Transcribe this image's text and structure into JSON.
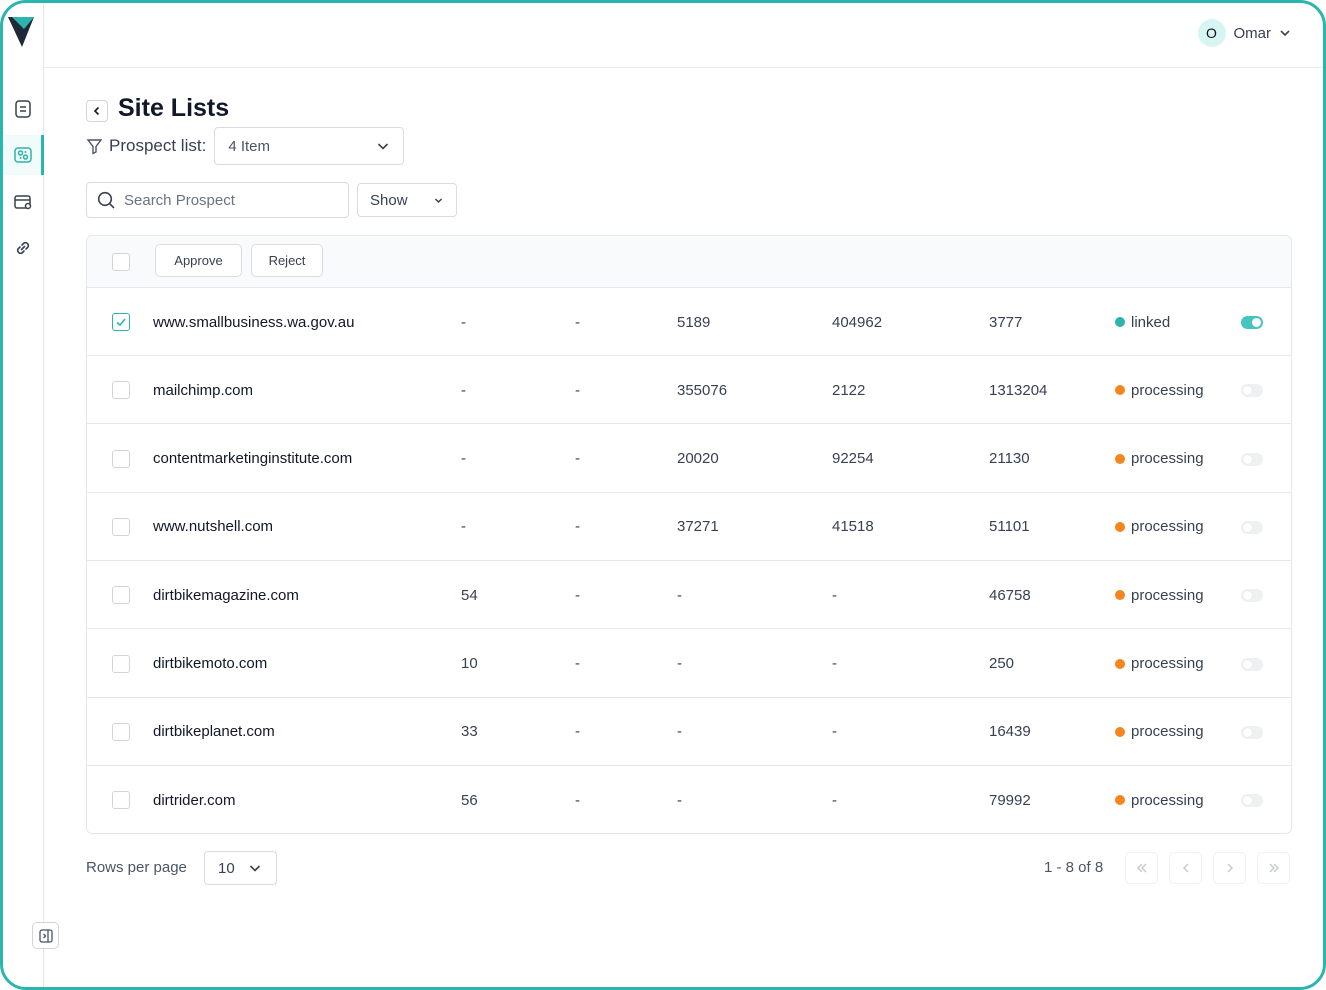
{
  "user": {
    "initial": "O",
    "name": "Omar"
  },
  "page": {
    "title": "Site Lists"
  },
  "prospect": {
    "label": "Prospect list:",
    "selected": "4 Item"
  },
  "search": {
    "placeholder": "Search Prospect",
    "value": ""
  },
  "show_filter": {
    "label": "Show"
  },
  "table_actions": {
    "approve": "Approve",
    "reject": "Reject"
  },
  "rows": [
    {
      "domain": "www.smallbusiness.wa.gov.au",
      "c1": "-",
      "c2": "-",
      "c3": "5189",
      "c4": "404962",
      "c5": "3777",
      "status": "linked",
      "status_color": "#2bb5ad",
      "checked": true,
      "toggle_on": true
    },
    {
      "domain": "mailchimp.com",
      "c1": "-",
      "c2": "-",
      "c3": "355076",
      "c4": "2122",
      "c5": "1313204",
      "status": "processing",
      "status_color": "#f5861f",
      "checked": false,
      "toggle_on": false
    },
    {
      "domain": "contentmarketinginstitute.com",
      "c1": "-",
      "c2": "-",
      "c3": "20020",
      "c4": "92254",
      "c5": "21130",
      "status": "processing",
      "status_color": "#f5861f",
      "checked": false,
      "toggle_on": false
    },
    {
      "domain": "www.nutshell.com",
      "c1": "-",
      "c2": "-",
      "c3": "37271",
      "c4": "41518",
      "c5": "51101",
      "status": "processing",
      "status_color": "#f5861f",
      "checked": false,
      "toggle_on": false
    },
    {
      "domain": "dirtbikemagazine.com",
      "c1": "54",
      "c2": "-",
      "c3": "-",
      "c4": "-",
      "c5": "46758",
      "status": "processing",
      "status_color": "#f5861f",
      "checked": false,
      "toggle_on": false
    },
    {
      "domain": "dirtbikemoto.com",
      "c1": "10",
      "c2": "-",
      "c3": "-",
      "c4": "-",
      "c5": "250",
      "status": "processing",
      "status_color": "#f5861f",
      "checked": false,
      "toggle_on": false
    },
    {
      "domain": "dirtbikeplanet.com",
      "c1": "33",
      "c2": "-",
      "c3": "-",
      "c4": "-",
      "c5": "16439",
      "status": "processing",
      "status_color": "#f5861f",
      "checked": false,
      "toggle_on": false
    },
    {
      "domain": "dirtrider.com",
      "c1": "56",
      "c2": "-",
      "c3": "-",
      "c4": "-",
      "c5": "79992",
      "status": "processing",
      "status_color": "#f5861f",
      "checked": false,
      "toggle_on": false
    }
  ],
  "pagination": {
    "rows_label": "Rows per page",
    "rows_value": "10",
    "info": "1 - 8 of 8"
  },
  "colors": {
    "accent": "#2bb5ad",
    "processing": "#f5861f"
  },
  "icons": {
    "sidebar": [
      "document-icon",
      "sites-icon",
      "card-settings-icon",
      "link-icon"
    ],
    "pager": [
      "first-page-icon",
      "prev-page-icon",
      "next-page-icon",
      "last-page-icon"
    ]
  }
}
